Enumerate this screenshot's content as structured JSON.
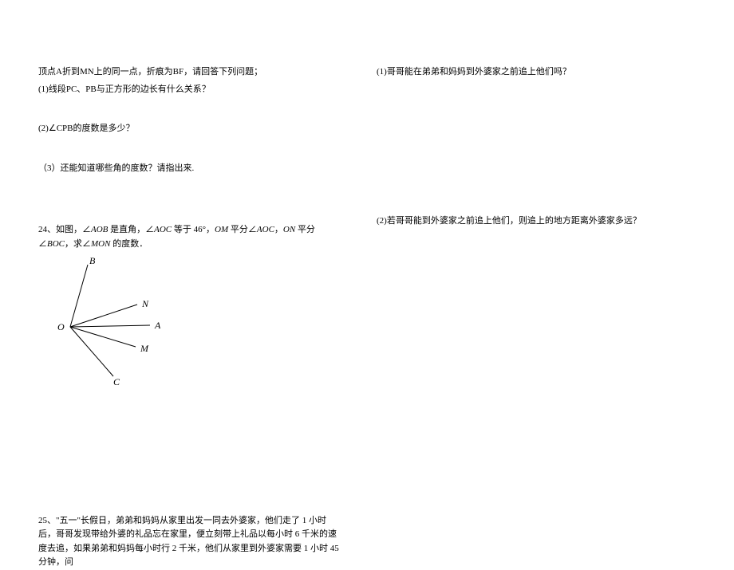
{
  "left": {
    "intro": "顶点A折到MN上的同一点，折痕为BF，请回答下列问题；",
    "q1": "(1)线段PC、PB与正方形的边长有什么关系？",
    "q2": "(2)∠CPB的度数是多少？",
    "q3": "（3）还能知道哪些角的度数？请指出来.",
    "q24_a": "24、如图，∠",
    "q24_aob": "AOB",
    "q24_b": " 是直角，∠",
    "q24_aoc": "AOC",
    "q24_c": " 等于 46°，",
    "q24_om": "OM",
    "q24_d": " 平分∠",
    "q24_aoc2": "AOC",
    "q24_e": "，",
    "q24_on": "ON",
    "q24_f": " 平分∠",
    "q24_boc": "BOC",
    "q24_g": "，求∠",
    "q24_mon": "MON",
    "q24_h": " 的度数．",
    "labels": {
      "B": "B",
      "N": "N",
      "A": "A",
      "M": "M",
      "C": "C",
      "O": "O"
    },
    "q25": "25、\"五一\"长假日，弟弟和妈妈从家里出发一同去外婆家，他们走了 1 小时后，哥哥发现带给外婆的礼品忘在家里，便立刻带上礼品以每小时 6 千米的速度去追，如果弟弟和妈妈每小时行 2 千米，他们从家里到外婆家需要 1 小时 45 分钟，问"
  },
  "right": {
    "r1": "(1)哥哥能在弟弟和妈妈到外婆家之前追上他们吗？",
    "r2": "(2)若哥哥能到外婆家之前追上他们，则追上的地方距离外婆家多远？"
  }
}
